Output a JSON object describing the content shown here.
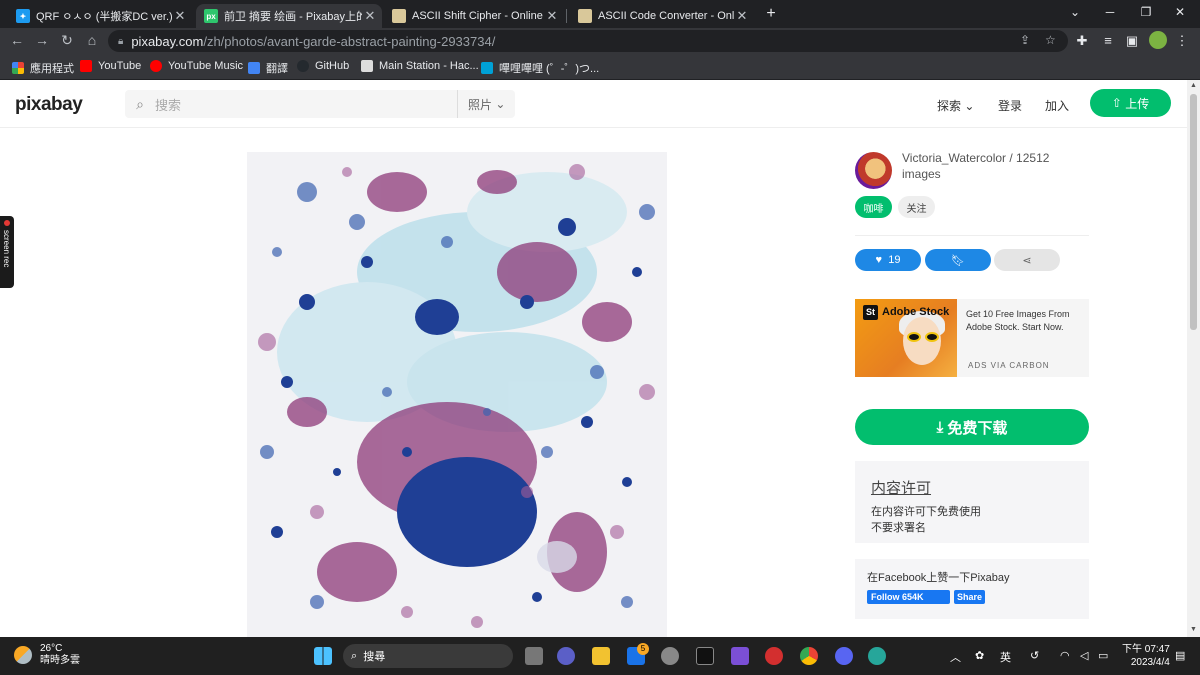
{
  "browser": {
    "tabs": [
      {
        "title": "QRF ㅇㅅㅇ (半搬家DC ver.) on",
        "icon": "twitter-icon",
        "color": "#1d9bf0"
      },
      {
        "title": "前卫 摘要 绘画 - Pixabay上的免费",
        "icon": "pixabay-icon",
        "color": "#2ec66d",
        "active": true
      },
      {
        "title": "ASCII Shift Cipher - Online Dec",
        "icon": "dcode-icon",
        "color": "#d9c89a"
      },
      {
        "title": "ASCII Code Converter - Online",
        "icon": "dcode-icon",
        "color": "#d9c89a"
      }
    ],
    "url_domain": "pixabay.com",
    "url_path": "/zh/photos/avant-garde-abstract-painting-2933734/",
    "bookmarks": [
      {
        "label": "應用程式",
        "icon": "apps-grid-icon",
        "color": "#ea4335"
      },
      {
        "label": "YouTube",
        "icon": "youtube-icon",
        "color": "#ff0000"
      },
      {
        "label": "YouTube Music",
        "icon": "youtube-music-icon",
        "color": "#ff0000"
      },
      {
        "label": "翻譯",
        "icon": "translate-icon",
        "color": "#4285f4"
      },
      {
        "label": "GitHub",
        "icon": "github-icon",
        "color": "#24292e"
      },
      {
        "label": "Main Station - Hac...",
        "icon": "document-icon",
        "color": "#dddddd"
      },
      {
        "label": "嗶哩嗶哩 (゜-゜)つ...",
        "icon": "bilibili-icon",
        "color": "#00a1d6"
      }
    ]
  },
  "site": {
    "logo": "pixabay",
    "search_placeholder": "搜索",
    "search_category": "照片",
    "nav": {
      "explore": "探索",
      "login": "登录",
      "join": "加入",
      "upload": "上传"
    }
  },
  "author": {
    "name_line": "Victoria_Watercolor / 12512 images",
    "coffee": "咖啡",
    "follow": "关注"
  },
  "actions": {
    "likes": "19"
  },
  "ad": {
    "brand": "Adobe Stock",
    "brand_short": "St",
    "text": "Get 10 Free Images From Adobe Stock. Start Now.",
    "via": "ADS VIA CARBON"
  },
  "download": {
    "label": "免费下载"
  },
  "license": {
    "title": "内容许可",
    "line1": "在内容许可下免费使用",
    "line2": "不要求署名"
  },
  "facebook": {
    "text": "在Facebook上赞一下Pixabay",
    "follow": "Follow 654K",
    "share": "Share"
  },
  "screenrec": {
    "label": "screen rec"
  },
  "taskbar": {
    "weather_temp": "26°C",
    "weather_desc": "晴時多雲",
    "search": "搜尋",
    "ime": "英",
    "time": "下午 07:47",
    "date": "2023/4/4",
    "mail_badge": "5"
  }
}
